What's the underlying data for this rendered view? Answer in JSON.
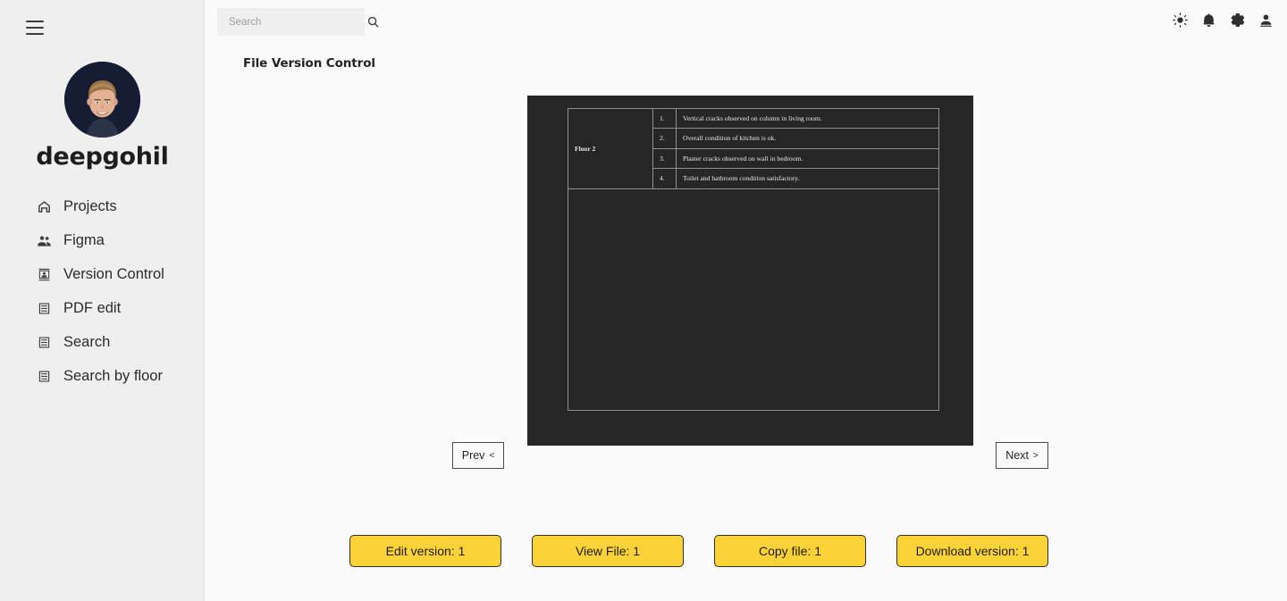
{
  "sidebar": {
    "menu_icon": "hamburger-menu-icon",
    "avatar_alt": "user-avatar",
    "username": "deepgohil",
    "items": [
      {
        "label": "Projects",
        "icon": "home-icon"
      },
      {
        "label": "Figma",
        "icon": "people-group-icon"
      },
      {
        "label": "Version Control",
        "icon": "account-box-icon"
      },
      {
        "label": "PDF edit",
        "icon": "article-icon"
      },
      {
        "label": "Search",
        "icon": "article-icon"
      },
      {
        "label": "Search by floor",
        "icon": "article-icon"
      }
    ]
  },
  "topbar": {
    "search": {
      "placeholder": "Search",
      "value": "",
      "icon": "search-icon"
    },
    "icons": [
      {
        "name": "brightness-icon"
      },
      {
        "name": "notifications-bell-icon"
      },
      {
        "name": "settings-gear-icon"
      },
      {
        "name": "account-person-icon"
      }
    ]
  },
  "main": {
    "page_title": "File Version Control",
    "document": {
      "floor_label": "Floor 2",
      "rows": [
        {
          "num": "1.",
          "text": "Vertical cracks observed on column in living room."
        },
        {
          "num": "2.",
          "text": "Overall condition of kitchen is ok."
        },
        {
          "num": "3.",
          "text": "Plaster cracks observed on wall in bedroom."
        },
        {
          "num": "4.",
          "text": "Toilet and bathroom condition satisfactory."
        }
      ]
    },
    "pagination": {
      "prev_label": "Prev",
      "prev_chevron": "<",
      "next_label": "Next",
      "next_chevron": ">"
    },
    "actions": [
      {
        "label": "Edit version: 1"
      },
      {
        "label": "View File: 1"
      },
      {
        "label": "Copy file: 1"
      },
      {
        "label": "Download version: 1"
      }
    ]
  },
  "colors": {
    "sidebar_bg": "#f0eff0",
    "main_bg": "#fbfbfb",
    "accent_yellow": "#fbd338",
    "document_bg": "#262626",
    "avatar_bg": "#141d33"
  }
}
